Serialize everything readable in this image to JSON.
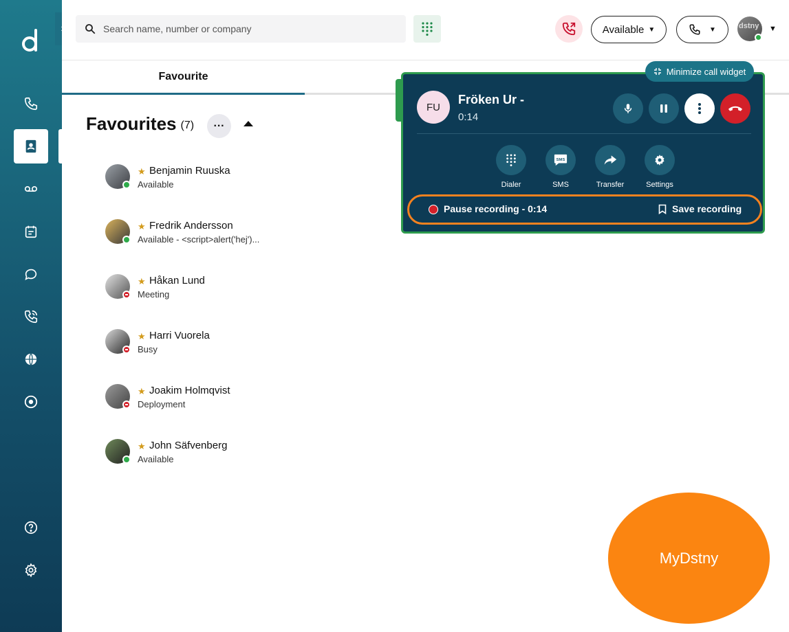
{
  "sidebar": {
    "items": [
      {
        "name": "calls",
        "icon": "phone-icon"
      },
      {
        "name": "contacts",
        "icon": "contacts-book-icon",
        "active": true
      },
      {
        "name": "voicemail",
        "icon": "voicemail-icon"
      },
      {
        "name": "calendar",
        "icon": "calendar-icon"
      },
      {
        "name": "chat",
        "icon": "chat-bubble-icon"
      },
      {
        "name": "call-history",
        "icon": "phone-history-icon"
      },
      {
        "name": "web",
        "icon": "globe-icon"
      },
      {
        "name": "media",
        "icon": "disc-icon"
      },
      {
        "name": "help",
        "icon": "help-icon"
      },
      {
        "name": "settings",
        "icon": "gear-icon"
      }
    ]
  },
  "header": {
    "search_placeholder": "Search name, number or company",
    "status_label": "Available",
    "user_avatar_text": "dstny"
  },
  "tabs": {
    "favourite_label": "Favourite"
  },
  "favourites": {
    "title": "Favourites",
    "count": "(7)",
    "more_label": "···",
    "contacts": [
      {
        "name": "Benjamin Ruuska",
        "status": "Available",
        "presence": "green"
      },
      {
        "name": "Fredrik Andersson",
        "status": "Available - <script>alert('hej')...",
        "presence": "green"
      },
      {
        "name": "Håkan Lund",
        "status": "Meeting",
        "presence": "red"
      },
      {
        "name": "Harri Vuorela",
        "status": "Busy",
        "presence": "red"
      },
      {
        "name": "Joakim Holmqvist",
        "status": "Deployment",
        "presence": "red"
      },
      {
        "name": "John Säfvenberg",
        "status": "Available",
        "presence": "green"
      }
    ]
  },
  "call_widget": {
    "minimize_label": "Minimize call widget",
    "caller_initials": "FU",
    "caller_name": "Fröken Ur -",
    "timer": "0:14",
    "actions": [
      {
        "label": "Dialer",
        "icon": "dialpad-icon"
      },
      {
        "label": "SMS",
        "icon": "sms-icon"
      },
      {
        "label": "Transfer",
        "icon": "transfer-icon"
      },
      {
        "label": "Settings",
        "icon": "gear-icon"
      }
    ],
    "recording_label": "Pause recording - 0:14",
    "save_recording_label": "Save recording"
  },
  "brand_bubble": {
    "label": "MyDstny"
  },
  "colors": {
    "sidebar_top": "#1f7a8c",
    "sidebar_bottom": "#0e3b55",
    "widget_bg": "#0d3b55",
    "widget_border": "#2e9b4e",
    "hangup_red": "#d32029",
    "highlight_orange": "#f5821f",
    "bubble_orange": "#fb8511"
  }
}
